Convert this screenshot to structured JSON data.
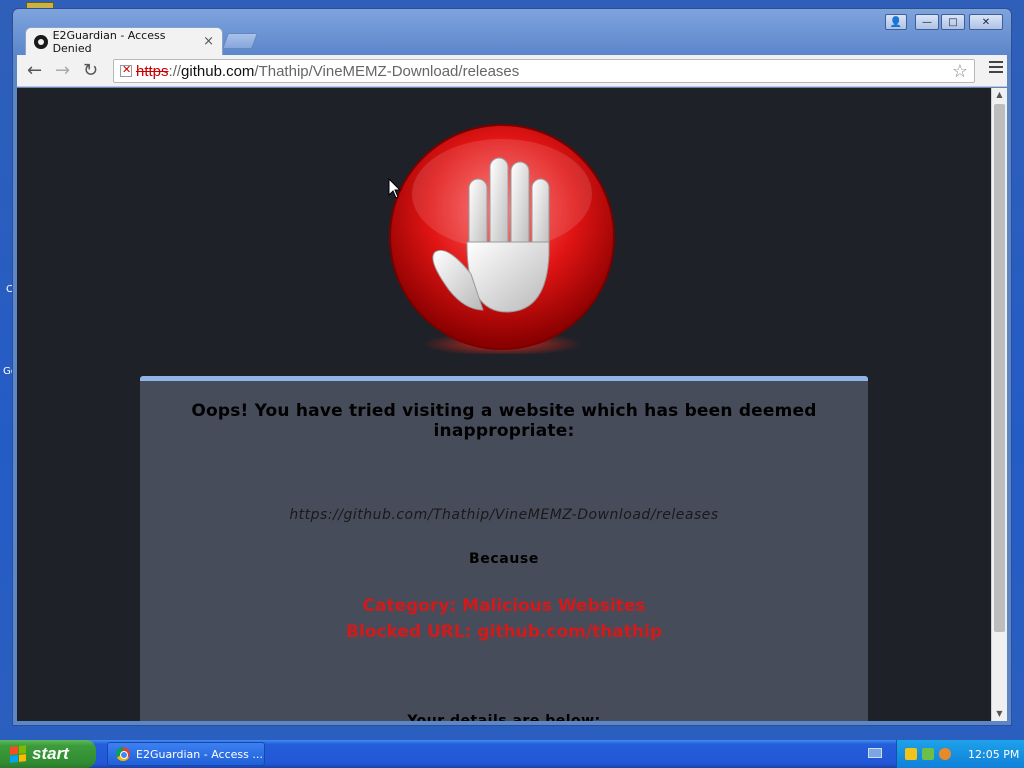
{
  "desktop": {
    "fragments": [
      "C",
      "Go"
    ]
  },
  "window": {
    "tab": {
      "title": "E2Guardian - Access Denied",
      "close": "×"
    },
    "controls": {
      "user": "👤",
      "minimize": "—",
      "maximize": "□",
      "close": "✕"
    }
  },
  "toolbar": {
    "back": "←",
    "forward": "→",
    "reload": "↻",
    "url_scheme": "https",
    "url_separator": "://",
    "url_host": "github.com",
    "url_path": "/Thathip/VineMEMZ-Download/releases",
    "star": "☆"
  },
  "page": {
    "headline": "Oops! You have tried visiting a website which has been deemed inappropriate:",
    "blocked_url": "https://github.com/Thathip/VineMEMZ-Download/releases",
    "because": "Because",
    "reason_category": "Category: Malicious Websites",
    "reason_blocked": "Blocked URL: github.com/thathip",
    "details": "Your details are below:"
  },
  "colors": {
    "page_background": "#1e2127",
    "panel_background": "#474c5a",
    "panel_accent": "#8fb5e8",
    "reason_text": "#d21a1a"
  },
  "taskbar": {
    "start_label": "start",
    "task_label": "E2Guardian - Access ...",
    "clock": "12:05 PM"
  }
}
